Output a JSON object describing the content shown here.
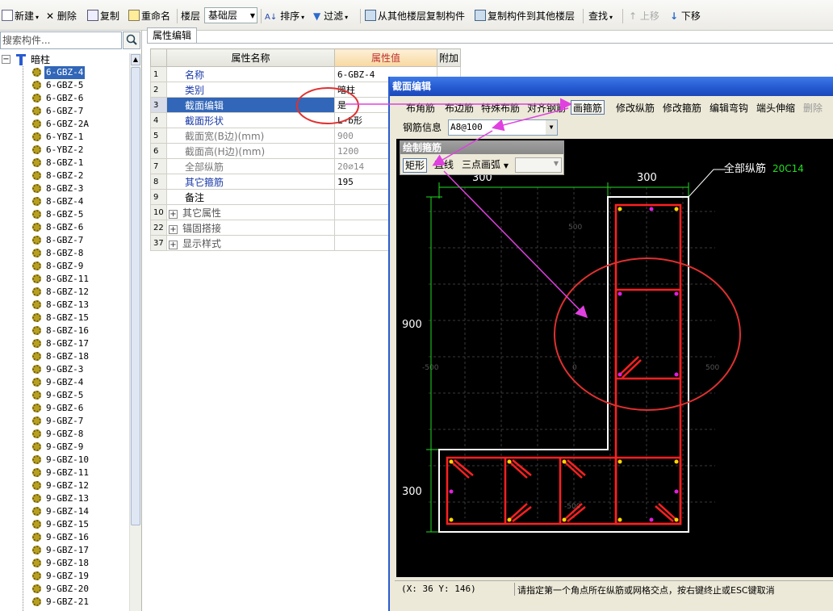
{
  "toolbar": {
    "new": "新建",
    "delete": "删除",
    "copy": "复制",
    "rename": "重命名",
    "floor_label": "楼层",
    "floor_value": "基础层",
    "sort": "排序",
    "filter": "过滤",
    "copy_from_floor": "从其他楼层复制构件",
    "copy_to_floor": "复制构件到其他楼层",
    "find": "查找",
    "move_up": "上移",
    "move_down": "下移"
  },
  "search": {
    "placeholder": "搜索构件..."
  },
  "tree": {
    "root": "暗柱",
    "items": [
      "6-GBZ-4",
      "6-GBZ-5",
      "6-GBZ-6",
      "6-GBZ-7",
      "6-GBZ-2A",
      "6-YBZ-1",
      "6-YBZ-2",
      "8-GBZ-1",
      "8-GBZ-2",
      "8-GBZ-3",
      "8-GBZ-4",
      "8-GBZ-5",
      "8-GBZ-6",
      "8-GBZ-7",
      "8-GBZ-8",
      "8-GBZ-9",
      "8-GBZ-11",
      "8-GBZ-12",
      "8-GBZ-13",
      "8-GBZ-15",
      "8-GBZ-16",
      "8-GBZ-17",
      "8-GBZ-18",
      "9-GBZ-3",
      "9-GBZ-4",
      "9-GBZ-5",
      "9-GBZ-6",
      "9-GBZ-7",
      "9-GBZ-8",
      "9-GBZ-9",
      "9-GBZ-10",
      "9-GBZ-11",
      "9-GBZ-12",
      "9-GBZ-13",
      "9-GBZ-14",
      "9-GBZ-15",
      "9-GBZ-16",
      "9-GBZ-17",
      "9-GBZ-18",
      "9-GBZ-19",
      "9-GBZ-20",
      "9-GBZ-21"
    ],
    "selected": "6-GBZ-4"
  },
  "properties": {
    "tab": "属性编辑",
    "headers": {
      "name": "属性名称",
      "value": "属性值",
      "extra": "附加"
    },
    "rows": [
      {
        "num": "1",
        "name": "名称",
        "value": "6-GBZ-4"
      },
      {
        "num": "2",
        "name": "类别",
        "value": "暗柱"
      },
      {
        "num": "3",
        "name": "截面编辑",
        "value": "是"
      },
      {
        "num": "4",
        "name": "截面形状",
        "value": "L-b形"
      },
      {
        "num": "5",
        "name": "截面宽(B边)(mm)",
        "value": "900"
      },
      {
        "num": "6",
        "name": "截面高(H边)(mm)",
        "value": "1200"
      },
      {
        "num": "7",
        "name": "全部纵筋",
        "value": "20⌀14"
      },
      {
        "num": "8",
        "name": "其它箍筋",
        "value": "195"
      },
      {
        "num": "9",
        "name": "备注",
        "value": ""
      },
      {
        "num": "10",
        "name": "其它属性",
        "value": ""
      },
      {
        "num": "22",
        "name": "锚固搭接",
        "value": ""
      },
      {
        "num": "37",
        "name": "显示样式",
        "value": ""
      }
    ]
  },
  "dialog": {
    "title": "截面编辑",
    "toolbar": [
      "布角筋",
      "布边筋",
      "特殊布筋",
      "对齐钢筋",
      "画箍筋",
      "修改纵筋",
      "修改箍筋",
      "编辑弯钩",
      "端头伸缩",
      "删除"
    ],
    "rebar_label": "钢筋信息",
    "rebar_value": "A8@100",
    "draw_panel": {
      "title": "绘制箍筋",
      "rect": "矩形",
      "line": "直线",
      "arc": "三点画弧"
    },
    "canvas": {
      "dim_top_left": "300",
      "dim_top_right": "300",
      "dim_left_top": "900",
      "dim_left_bottom": "300",
      "all_rebar_label": "全部纵筋",
      "all_rebar_value": "20C14",
      "grid_labels": [
        "500",
        "-500",
        "0",
        "500",
        "-500"
      ]
    },
    "status": {
      "coord": "(X: 36 Y: 146)",
      "hint": "请指定第一个角点所在纵筋或网格交点，按右键终止或ESC键取消"
    }
  },
  "colors": {
    "rebar": "#ff2020",
    "outline": "#ffffff",
    "dimension": "#22dd22",
    "annotation": "#e040e0",
    "highlight_circle": "#e03030",
    "selection": "#3166b8"
  }
}
